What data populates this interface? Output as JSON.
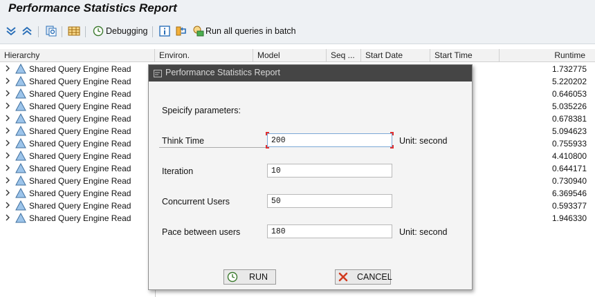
{
  "header": {
    "title": "Performance Statistics Report"
  },
  "toolbar": {
    "debugging_label": "Debugging",
    "run_batch_label": "Run all queries in batch"
  },
  "grid": {
    "columns": [
      "Hierarchy",
      "Environ.",
      "Model",
      "Seq ...",
      "Start Date",
      "Start Time",
      "Runtime"
    ],
    "rows": [
      {
        "name": "Shared Query Engine Read",
        "runtime": "1.732775"
      },
      {
        "name": "Shared Query Engine Read",
        "runtime": "5.220202"
      },
      {
        "name": "Shared Query Engine Read",
        "runtime": "0.646053"
      },
      {
        "name": "Shared Query Engine Read",
        "runtime": "5.035226"
      },
      {
        "name": "Shared Query Engine Read",
        "runtime": "0.678381"
      },
      {
        "name": "Shared Query Engine Read",
        "runtime": "5.094623"
      },
      {
        "name": "Shared Query Engine Read",
        "runtime": "0.755933"
      },
      {
        "name": "Shared Query Engine Read",
        "runtime": "4.410800"
      },
      {
        "name": "Shared Query Engine Read",
        "runtime": "0.644171"
      },
      {
        "name": "Shared Query Engine Read",
        "runtime": "0.730940"
      },
      {
        "name": "Shared Query Engine Read",
        "runtime": "6.369546"
      },
      {
        "name": "Shared Query Engine Read",
        "runtime": "0.593377"
      },
      {
        "name": "Shared Query Engine Read",
        "runtime": "1.946330"
      }
    ]
  },
  "dialog": {
    "title": "Performance Statistics Report",
    "prompt": "Speicify parameters:",
    "fields": {
      "think_time": {
        "label": "Think Time",
        "value": "200",
        "unit": "Unit: second"
      },
      "iteration": {
        "label": "Iteration",
        "value": "10"
      },
      "concurrent_users": {
        "label": "Concurrent Users",
        "value": "50"
      },
      "pace": {
        "label": "Pace between users",
        "value": "180",
        "unit": "Unit: second"
      }
    },
    "run_label": "RUN",
    "cancel_label": "CANCEL"
  },
  "colors": {
    "dialog_header": "#454545",
    "focus_marker": "#e03030",
    "icon_blue": "#2a6fb8"
  }
}
